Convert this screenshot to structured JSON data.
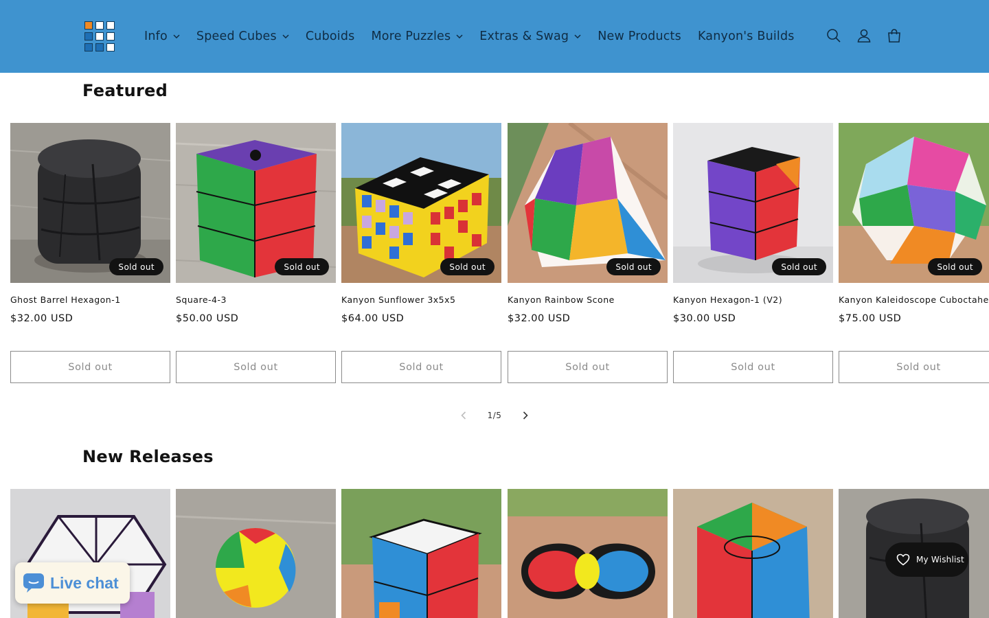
{
  "header": {
    "nav": [
      {
        "label": "Info",
        "has_dropdown": true
      },
      {
        "label": "Speed Cubes",
        "has_dropdown": true
      },
      {
        "label": "Cuboids",
        "has_dropdown": false
      },
      {
        "label": "More Puzzles",
        "has_dropdown": true
      },
      {
        "label": "Extras & Swag",
        "has_dropdown": true
      },
      {
        "label": "New Products",
        "has_dropdown": false
      },
      {
        "label": "Kanyon's Builds",
        "has_dropdown": false
      }
    ],
    "icons": [
      "search-icon",
      "account-icon",
      "cart-icon"
    ]
  },
  "featured": {
    "title": "Featured",
    "products": [
      {
        "name": "Ghost Barrel Hexagon-1",
        "price": "$32.00 USD",
        "badge": "Sold out",
        "button": "Sold out"
      },
      {
        "name": "Square-4-3",
        "price": "$50.00 USD",
        "badge": "Sold out",
        "button": "Sold out"
      },
      {
        "name": "Kanyon Sunflower 3x5x5",
        "price": "$64.00 USD",
        "badge": "Sold out",
        "button": "Sold out"
      },
      {
        "name": "Kanyon Rainbow Scone",
        "price": "$32.00 USD",
        "badge": "Sold out",
        "button": "Sold out"
      },
      {
        "name": "Kanyon Hexagon-1 (V2)",
        "price": "$30.00 USD",
        "badge": "Sold out",
        "button": "Sold out"
      },
      {
        "name": "Kanyon Kaleidoscope Cuboctahedron",
        "price": "$75.00 USD",
        "badge": "Sold out",
        "button": "Sold out"
      }
    ],
    "pagination": {
      "current": 1,
      "total": 5,
      "text": "1/5"
    }
  },
  "new_releases": {
    "title": "New Releases",
    "product_count_visible": 6
  },
  "live_chat": {
    "label": "Live chat"
  },
  "wishlist": {
    "label": "My Wishlist"
  },
  "colors": {
    "header_bg": "#3f93cf",
    "nav_text": "#0f2c44",
    "badge_bg": "#121212",
    "button_border": "#8a8a8a",
    "live_chat_text": "#4c8fd6"
  }
}
